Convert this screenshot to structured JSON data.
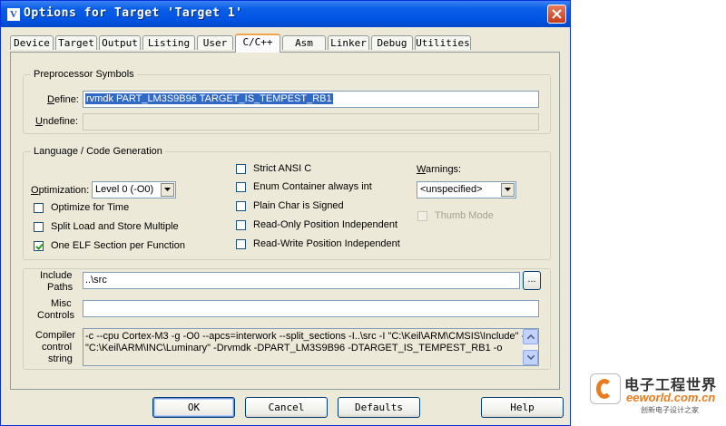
{
  "window": {
    "title": "Options for Target 'Target 1'",
    "icon_glyph": "V"
  },
  "tabs": [
    {
      "label": "Device",
      "active": false
    },
    {
      "label": "Target",
      "active": false
    },
    {
      "label": "Output",
      "active": false
    },
    {
      "label": "Listing",
      "active": false
    },
    {
      "label": "User",
      "active": false
    },
    {
      "label": "C/C++",
      "active": true
    },
    {
      "label": "Asm",
      "active": false
    },
    {
      "label": "Linker",
      "active": false
    },
    {
      "label": "Debug",
      "active": false
    },
    {
      "label": "Utilities",
      "active": false
    }
  ],
  "preprocessor": {
    "group_label": "Preprocessor Symbols",
    "define_label": "Define:",
    "define_value": "rvmdk PART_LM3S9B96 TARGET_IS_TEMPEST_RB1",
    "undefine_label": "Undefine:",
    "undefine_value": ""
  },
  "language": {
    "group_label": "Language / Code Generation",
    "optimization_label": "Optimization:",
    "optimization_value": "Level 0 (-O0)",
    "options": [
      {
        "label": "Optimize for Time",
        "checked": false
      },
      {
        "label": "Split Load and Store Multiple",
        "checked": false
      },
      {
        "label": "One ELF Section per Function",
        "checked": true
      }
    ],
    "options_right": [
      {
        "label": "Strict ANSI C",
        "checked": false
      },
      {
        "label": "Enum Container always int",
        "checked": false
      },
      {
        "label": "Plain Char is Signed",
        "checked": false
      },
      {
        "label": "Read-Only Position Independent",
        "checked": false
      },
      {
        "label": "Read-Write Position Independent",
        "checked": false
      }
    ],
    "warnings_label": "Warnings:",
    "warnings_value": "<unspecified>",
    "thumb_mode_label": "Thumb Mode",
    "thumb_mode_checked": false
  },
  "paths": {
    "include_label_1": "Include",
    "include_label_2": "Paths",
    "include_value": "..\\src",
    "browse_label": "...",
    "misc_label_1": "Misc",
    "misc_label_2": "Controls",
    "misc_value": "",
    "compiler_label_1": "Compiler",
    "compiler_label_2": "control",
    "compiler_label_3": "string",
    "compiler_line_1": "-c --cpu Cortex-M3 -g -O0 --apcs=interwork --split_sections -I..\\src -I \"C:\\Keil\\ARM\\CMSIS\\Include\" -I",
    "compiler_line_2": "\"C:\\Keil\\ARM\\INC\\Luminary\" -Drvmdk -DPART_LM3S9B96 -DTARGET_IS_TEMPEST_RB1 -o"
  },
  "buttons": {
    "ok": "OK",
    "cancel": "Cancel",
    "defaults": "Defaults",
    "help": "Help"
  },
  "watermark": {
    "cn": "电子工程世界",
    "en": "eeworld.com.cn",
    "sub": "创新电子设计之家"
  },
  "colors": {
    "titlebar": "#0054e3",
    "selection": "#316ac5",
    "dialog_bg": "#ece9d8",
    "tab_accent": "#f1a44c"
  }
}
